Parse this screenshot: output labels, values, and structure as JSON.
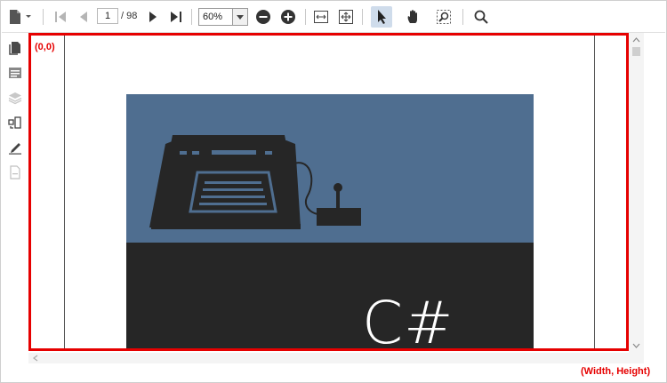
{
  "toolbar": {
    "page_number": "1",
    "page_total": "/ 98",
    "zoom": "60%",
    "icons": [
      "file-menu-icon",
      "first-page-icon",
      "previous-page-icon",
      "next-page-icon",
      "last-page-icon",
      "zoom-out-icon",
      "zoom-in-icon",
      "fit-width-icon",
      "fit-page-icon",
      "selection-tool-icon",
      "pan-tool-icon",
      "marquee-zoom-icon",
      "search-icon"
    ]
  },
  "sidebar": {
    "icons": [
      "page-thumbnails-icon",
      "bookmarks-icon",
      "layers-icon",
      "organize-pages-icon",
      "signature-icon",
      "form-fields-icon"
    ]
  },
  "document": {
    "cover_text": "C#",
    "cover_top_color": "#4f6e90",
    "cover_bottom_color": "#262626"
  },
  "annotations": {
    "origin": "(0,0)",
    "size": "(Width, Height)",
    "color": "#e60000"
  }
}
